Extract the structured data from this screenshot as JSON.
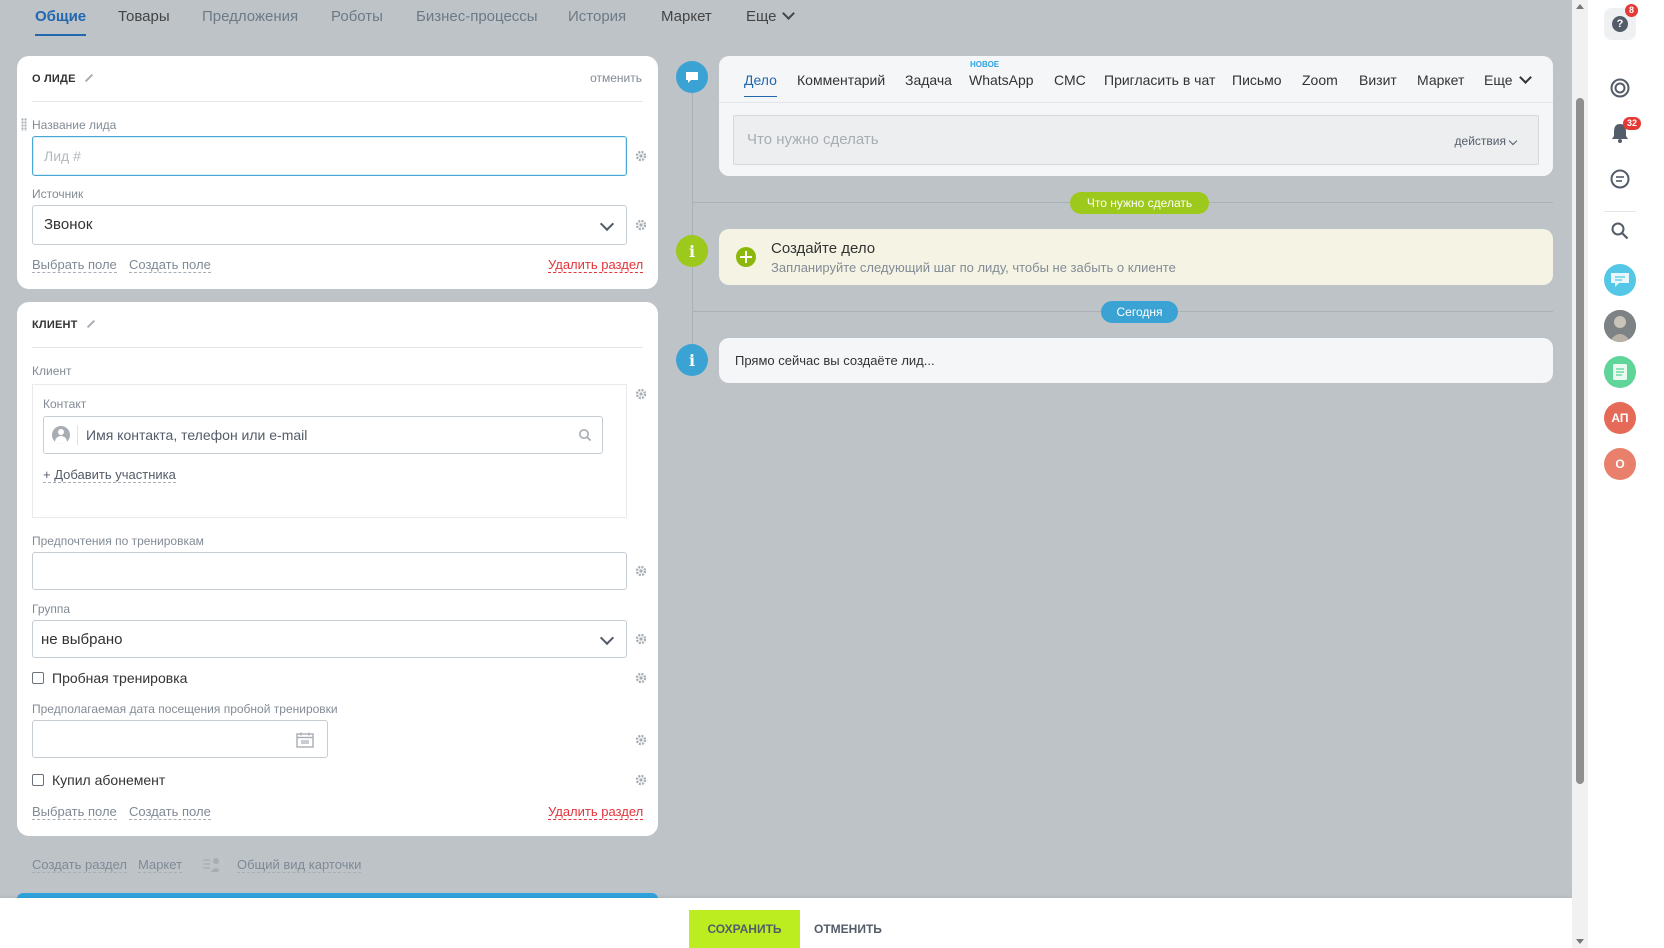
{
  "top_tabs": [
    {
      "label": "Общие"
    },
    {
      "label": "Товары"
    },
    {
      "label": "Предложения"
    },
    {
      "label": "Роботы"
    },
    {
      "label": "Бизнес-процессы"
    },
    {
      "label": "История"
    },
    {
      "label": "Маркет"
    },
    {
      "label": "Еще"
    }
  ],
  "lead_section": {
    "title": "О ЛИДЕ",
    "cancel": "отменить",
    "name_label": "Название лида",
    "name_placeholder": "Лид #",
    "source_label": "Источник",
    "source_value": "Звонок",
    "select_field": "Выбрать поле",
    "create_field": "Создать поле",
    "delete_section": "Удалить раздел"
  },
  "client_section": {
    "title": "КЛИЕНТ",
    "client_label": "Клиент",
    "contact_label": "Контакт",
    "contact_placeholder": "Имя контакта, телефон или e-mail",
    "add_participant": "+ Добавить участника",
    "prefs_label": "Предпочтения по тренировкам",
    "group_label": "Группа",
    "group_value": "не выбрано",
    "trial_label": "Пробная тренировка",
    "trial_date_label": "Предполагаемая дата посещения пробной тренировки",
    "bought_label": "Купил абонемент",
    "select_field": "Выбрать поле",
    "create_field": "Создать поле",
    "delete_section": "Удалить раздел"
  },
  "bottom_links": {
    "create_section": "Создать раздел",
    "market": "Маркет",
    "common_view": "Общий вид карточки"
  },
  "timeline": {
    "tabs": [
      "Дело",
      "Комментарий",
      "Задача",
      "WhatsApp",
      "СМС",
      "Пригласить в чат",
      "Письмо",
      "Zoom",
      "Визит",
      "Маркет",
      "Еще"
    ],
    "new_badge": "НОВОЕ",
    "todo_placeholder": "Что нужно сделать",
    "actions": "действия",
    "pill_todo": "Что нужно сделать",
    "create_title": "Создайте дело",
    "create_sub": "Запланируйте следующий шаг по лиду, чтобы не забыть о клиенте",
    "pill_today": "Сегодня",
    "now_text": "Прямо сейчас вы создаёте лид..."
  },
  "right_bar": {
    "help_badge": "8",
    "notif_badge": "32",
    "avatar_ap": "АП",
    "avatar_o": "О"
  },
  "footer": {
    "save": "СОХРАНИТЬ",
    "cancel": "ОТМЕНИТЬ"
  },
  "colors": {
    "accent": "#2067b0",
    "save": "#bbed21",
    "green": "#9dc81c",
    "blue_pill": "#3ba3d4",
    "danger": "#e3343a"
  }
}
